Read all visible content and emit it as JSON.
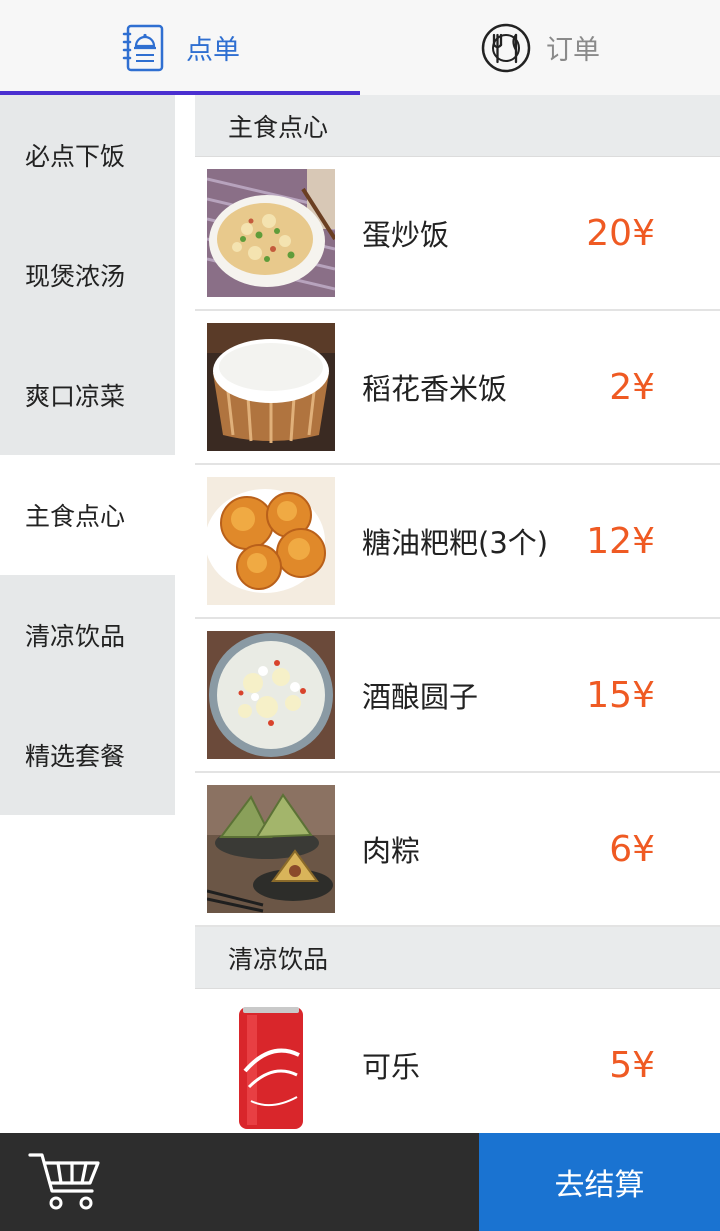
{
  "tabs": [
    {
      "label": "点单",
      "icon": "menu-book-icon",
      "active": true
    },
    {
      "label": "订单",
      "icon": "dining-plate-icon",
      "active": false
    }
  ],
  "colors": {
    "active_tab": "#2f6fd1",
    "underline": "#4a2fd0",
    "price": "#ef5a23",
    "checkout": "#1a73d1",
    "bottom_bar": "#2d2d2d"
  },
  "categories": [
    {
      "label": "必点下饭",
      "active": false
    },
    {
      "label": "现煲浓汤",
      "active": false
    },
    {
      "label": "爽口凉菜",
      "active": false
    },
    {
      "label": "主食点心",
      "active": true
    },
    {
      "label": "清凉饮品",
      "active": false
    },
    {
      "label": "精选套餐",
      "active": false
    }
  ],
  "sections": [
    {
      "title": "主食点心",
      "items": [
        {
          "name": "蛋炒饭",
          "price": "20¥",
          "image": "egg-fried-rice-image"
        },
        {
          "name": "稻花香米饭",
          "price": "2¥",
          "image": "steamed-rice-image"
        },
        {
          "name": "糖油粑粑(3个)",
          "price": "12¥",
          "image": "sugar-oil-cake-image"
        },
        {
          "name": "酒酿圆子",
          "price": "15¥",
          "image": "rice-ball-soup-image"
        },
        {
          "name": "肉粽",
          "price": "6¥",
          "image": "zongzi-image"
        }
      ]
    },
    {
      "title": "清凉饮品",
      "items": [
        {
          "name": "可乐",
          "price": "5¥",
          "image": "cola-can-image"
        }
      ]
    }
  ],
  "bottom": {
    "cart_icon": "shopping-cart-icon",
    "checkout_label": "去结算"
  }
}
